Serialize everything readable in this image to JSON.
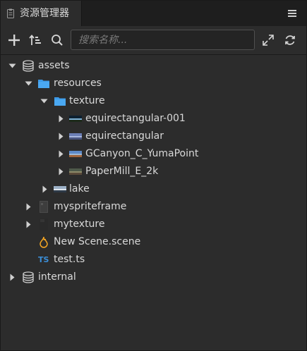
{
  "tab": {
    "title": "资源管理器",
    "icon": "clipboard-icon"
  },
  "toolbar": {
    "add_icon": "plus-icon",
    "sort_icon": "sort-icon",
    "search_icon": "search-icon",
    "search_placeholder": "搜索名称...",
    "search_value": "",
    "expand_icon": "expand-arrows-icon",
    "refresh_icon": "refresh-icon"
  },
  "colors": {
    "background": "#2c2c2c",
    "tabbar": "#1e1e1e",
    "folder": "#3c9ae8",
    "text": "#d9d9d9",
    "ts": "#3b8fd9",
    "scene": "#f5a623"
  },
  "tree": [
    {
      "label": "assets",
      "icon": "database-icon",
      "expanded": true
    },
    {
      "label": "resources",
      "icon": "folder-icon",
      "expanded": true
    },
    {
      "label": "texture",
      "icon": "folder-icon",
      "expanded": true
    },
    {
      "label": "equirectangular-001",
      "icon": "image-thumbnail-icon",
      "expanded": false
    },
    {
      "label": "equirectangular",
      "icon": "image-thumbnail-icon",
      "expanded": false
    },
    {
      "label": "GCanyon_C_YumaPoint",
      "icon": "image-thumbnail-icon",
      "expanded": false
    },
    {
      "label": "PaperMill_E_2k",
      "icon": "image-thumbnail-icon",
      "expanded": false
    },
    {
      "label": "lake",
      "icon": "image-thumbnail-icon",
      "expanded": false
    },
    {
      "label": "myspriteframe",
      "icon": "sprite-frame-icon",
      "expanded": false
    },
    {
      "label": "mytexture",
      "icon": "texture-icon",
      "expanded": false
    },
    {
      "label": "New Scene.scene",
      "icon": "scene-icon"
    },
    {
      "label": "test.ts",
      "icon": "typescript-icon",
      "badge": "TS"
    },
    {
      "label": "internal",
      "icon": "database-icon",
      "expanded": false
    }
  ]
}
